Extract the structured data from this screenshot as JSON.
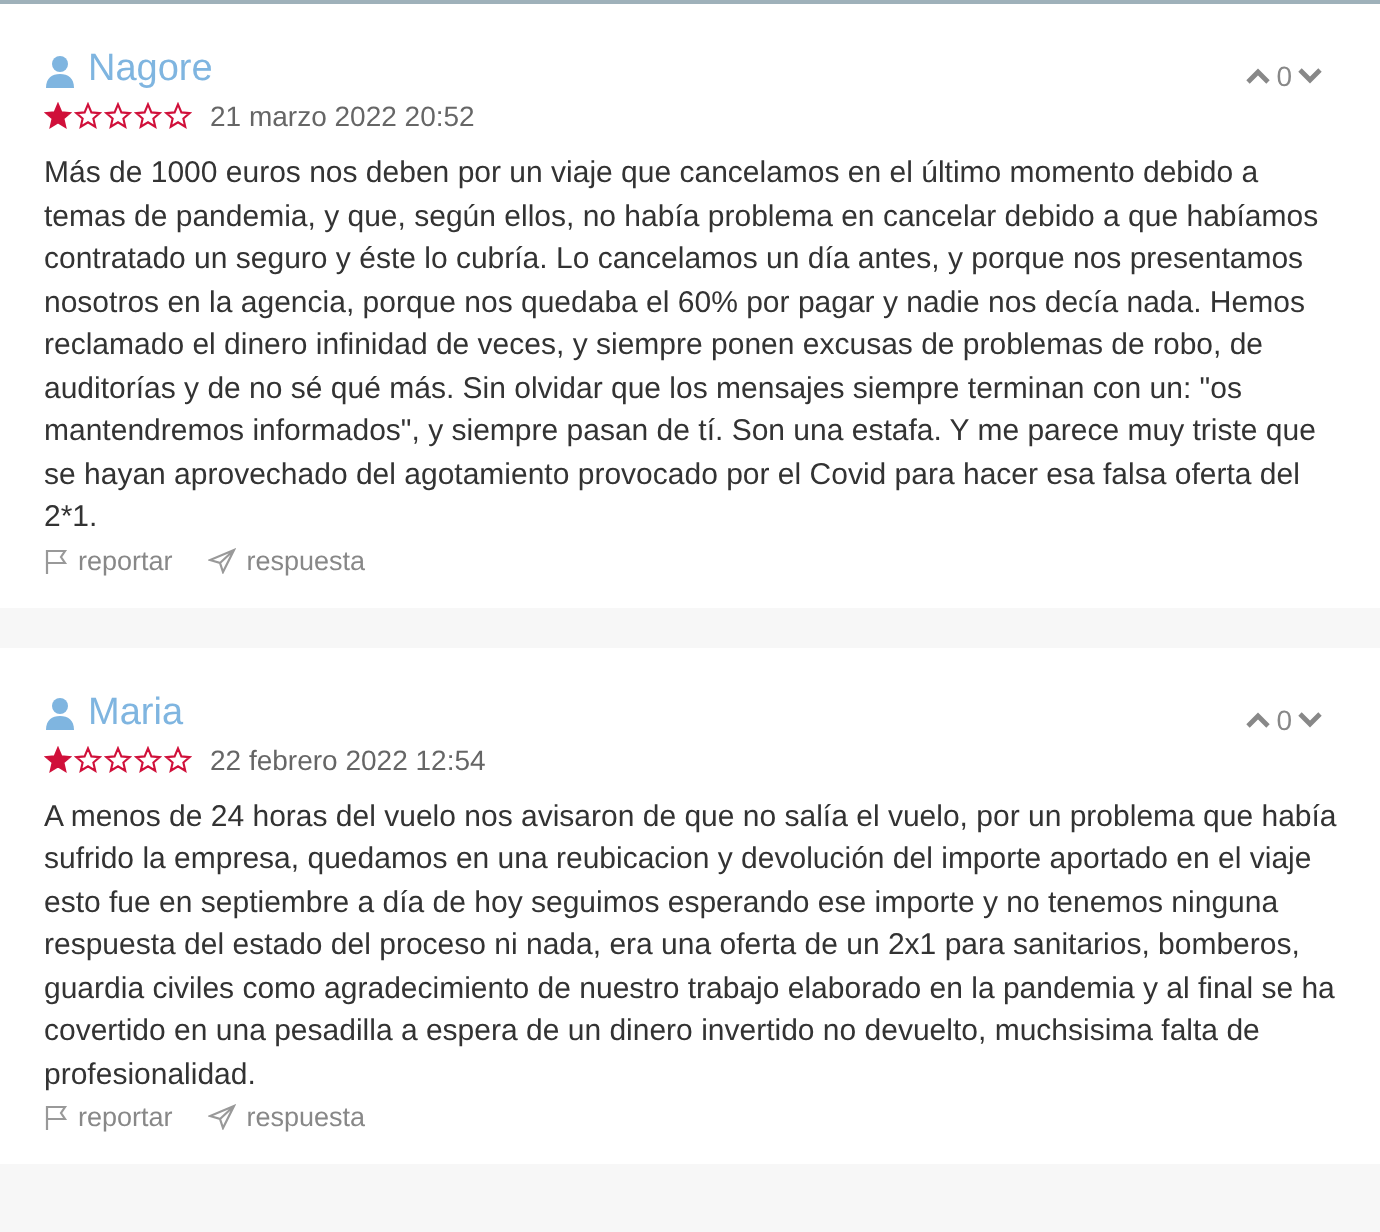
{
  "reviews": [
    {
      "author": "Nagore",
      "stars": 1,
      "date": "21 marzo 2022 20:52",
      "votes": "0",
      "text": "Más de 1000 euros nos deben por un viaje que cancelamos en el último momento debido a temas de pandemia, y que, según ellos, no había problema en cancelar debido a que habíamos contratado un seguro y éste lo cubría. Lo cancelamos un día antes, y porque nos presentamos nosotros en la agencia, porque nos quedaba el 60% por pagar y nadie nos decía nada. Hemos reclamado el dinero infinidad de veces, y siempre ponen excusas de problemas de robo, de auditorías y de no sé qué más. Sin olvidar que los mensajes siempre terminan con un: \"os mantendremos informados\", y siempre pasan de tí. Son una estafa. Y me parece muy triste que se hayan aprovechado del agotamiento provocado por el Covid para hacer esa falsa oferta del 2*1.",
      "report": "reportar",
      "reply": "respuesta"
    },
    {
      "author": "Maria",
      "stars": 1,
      "date": "22 febrero 2022 12:54",
      "votes": "0",
      "text": "A menos de 24 horas del vuelo nos avisaron de que no salía el vuelo, por un problema que había sufrido la empresa, quedamos en una reubicacion y devolución del importe aportado en el viaje esto fue en septiembre a día de hoy seguimos esperando ese importe y no tenemos ninguna respuesta del estado del proceso ni nada, era una oferta de un 2x1 para sanitarios, bomberos, guardia civiles como agradecimiento de nuestro trabajo elaborado en la pandemia y al final se ha covertido en una pesadilla a espera de un dinero invertido no devuelto, muchsisima falta de profesionalidad.",
      "report": "reportar",
      "reply": "respuesta"
    }
  ]
}
